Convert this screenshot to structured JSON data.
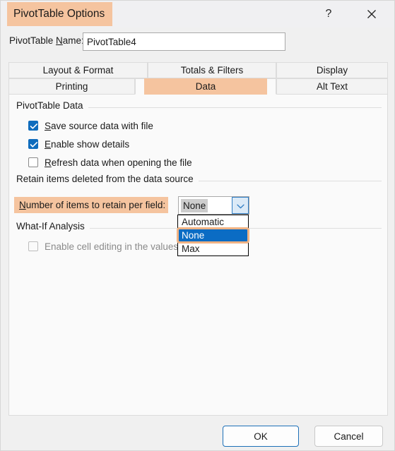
{
  "window": {
    "title": "PivotTable Options",
    "help_icon": "question-mark-icon",
    "close_icon": "close-icon"
  },
  "name_field": {
    "label_before": "PivotTable ",
    "label_accel": "N",
    "label_after": "ame:",
    "value": "PivotTable4"
  },
  "tabs": {
    "row1": [
      {
        "label": "Layout & Format",
        "selected": false
      },
      {
        "label": "Totals & Filters",
        "selected": false
      },
      {
        "label": "Display",
        "selected": false
      }
    ],
    "row2": [
      {
        "label": "Printing",
        "selected": false
      },
      {
        "label": "Data",
        "selected": true
      },
      {
        "label": "Alt Text",
        "selected": false
      }
    ]
  },
  "panel": {
    "groups": {
      "pivottable_data": {
        "title": "PivotTable Data",
        "checkboxes": [
          {
            "accel": "S",
            "rest": "ave source data with file",
            "checked": true,
            "disabled": false
          },
          {
            "accel": "E",
            "rest": "nable show details",
            "checked": true,
            "disabled": false
          },
          {
            "accel": "R",
            "rest": "efresh data when opening the file",
            "checked": false,
            "disabled": false
          }
        ]
      },
      "retain_items": {
        "title": "Retain items deleted from the data source",
        "combo_label_accel": "N",
        "combo_label_rest": "umber of items to retain per field:",
        "combo_value": "None",
        "combo_arrow_icon": "chevron-down-icon",
        "options": [
          {
            "label": "Automatic",
            "selected": false
          },
          {
            "label": "None",
            "selected": true
          },
          {
            "label": "Max",
            "selected": false
          }
        ]
      },
      "what_if": {
        "title": "What-If Analysis",
        "checkbox": {
          "label": "Enable cell editing in the values area",
          "checked": false,
          "disabled": true
        }
      }
    }
  },
  "footer": {
    "ok_label": "OK",
    "cancel_label": "Cancel"
  },
  "colors": {
    "highlight_orange": "#f5c49f",
    "selection_blue": "#0b6cc4",
    "checkbox_blue": "#0f6cbd",
    "primary_border": "#1d70b8"
  }
}
